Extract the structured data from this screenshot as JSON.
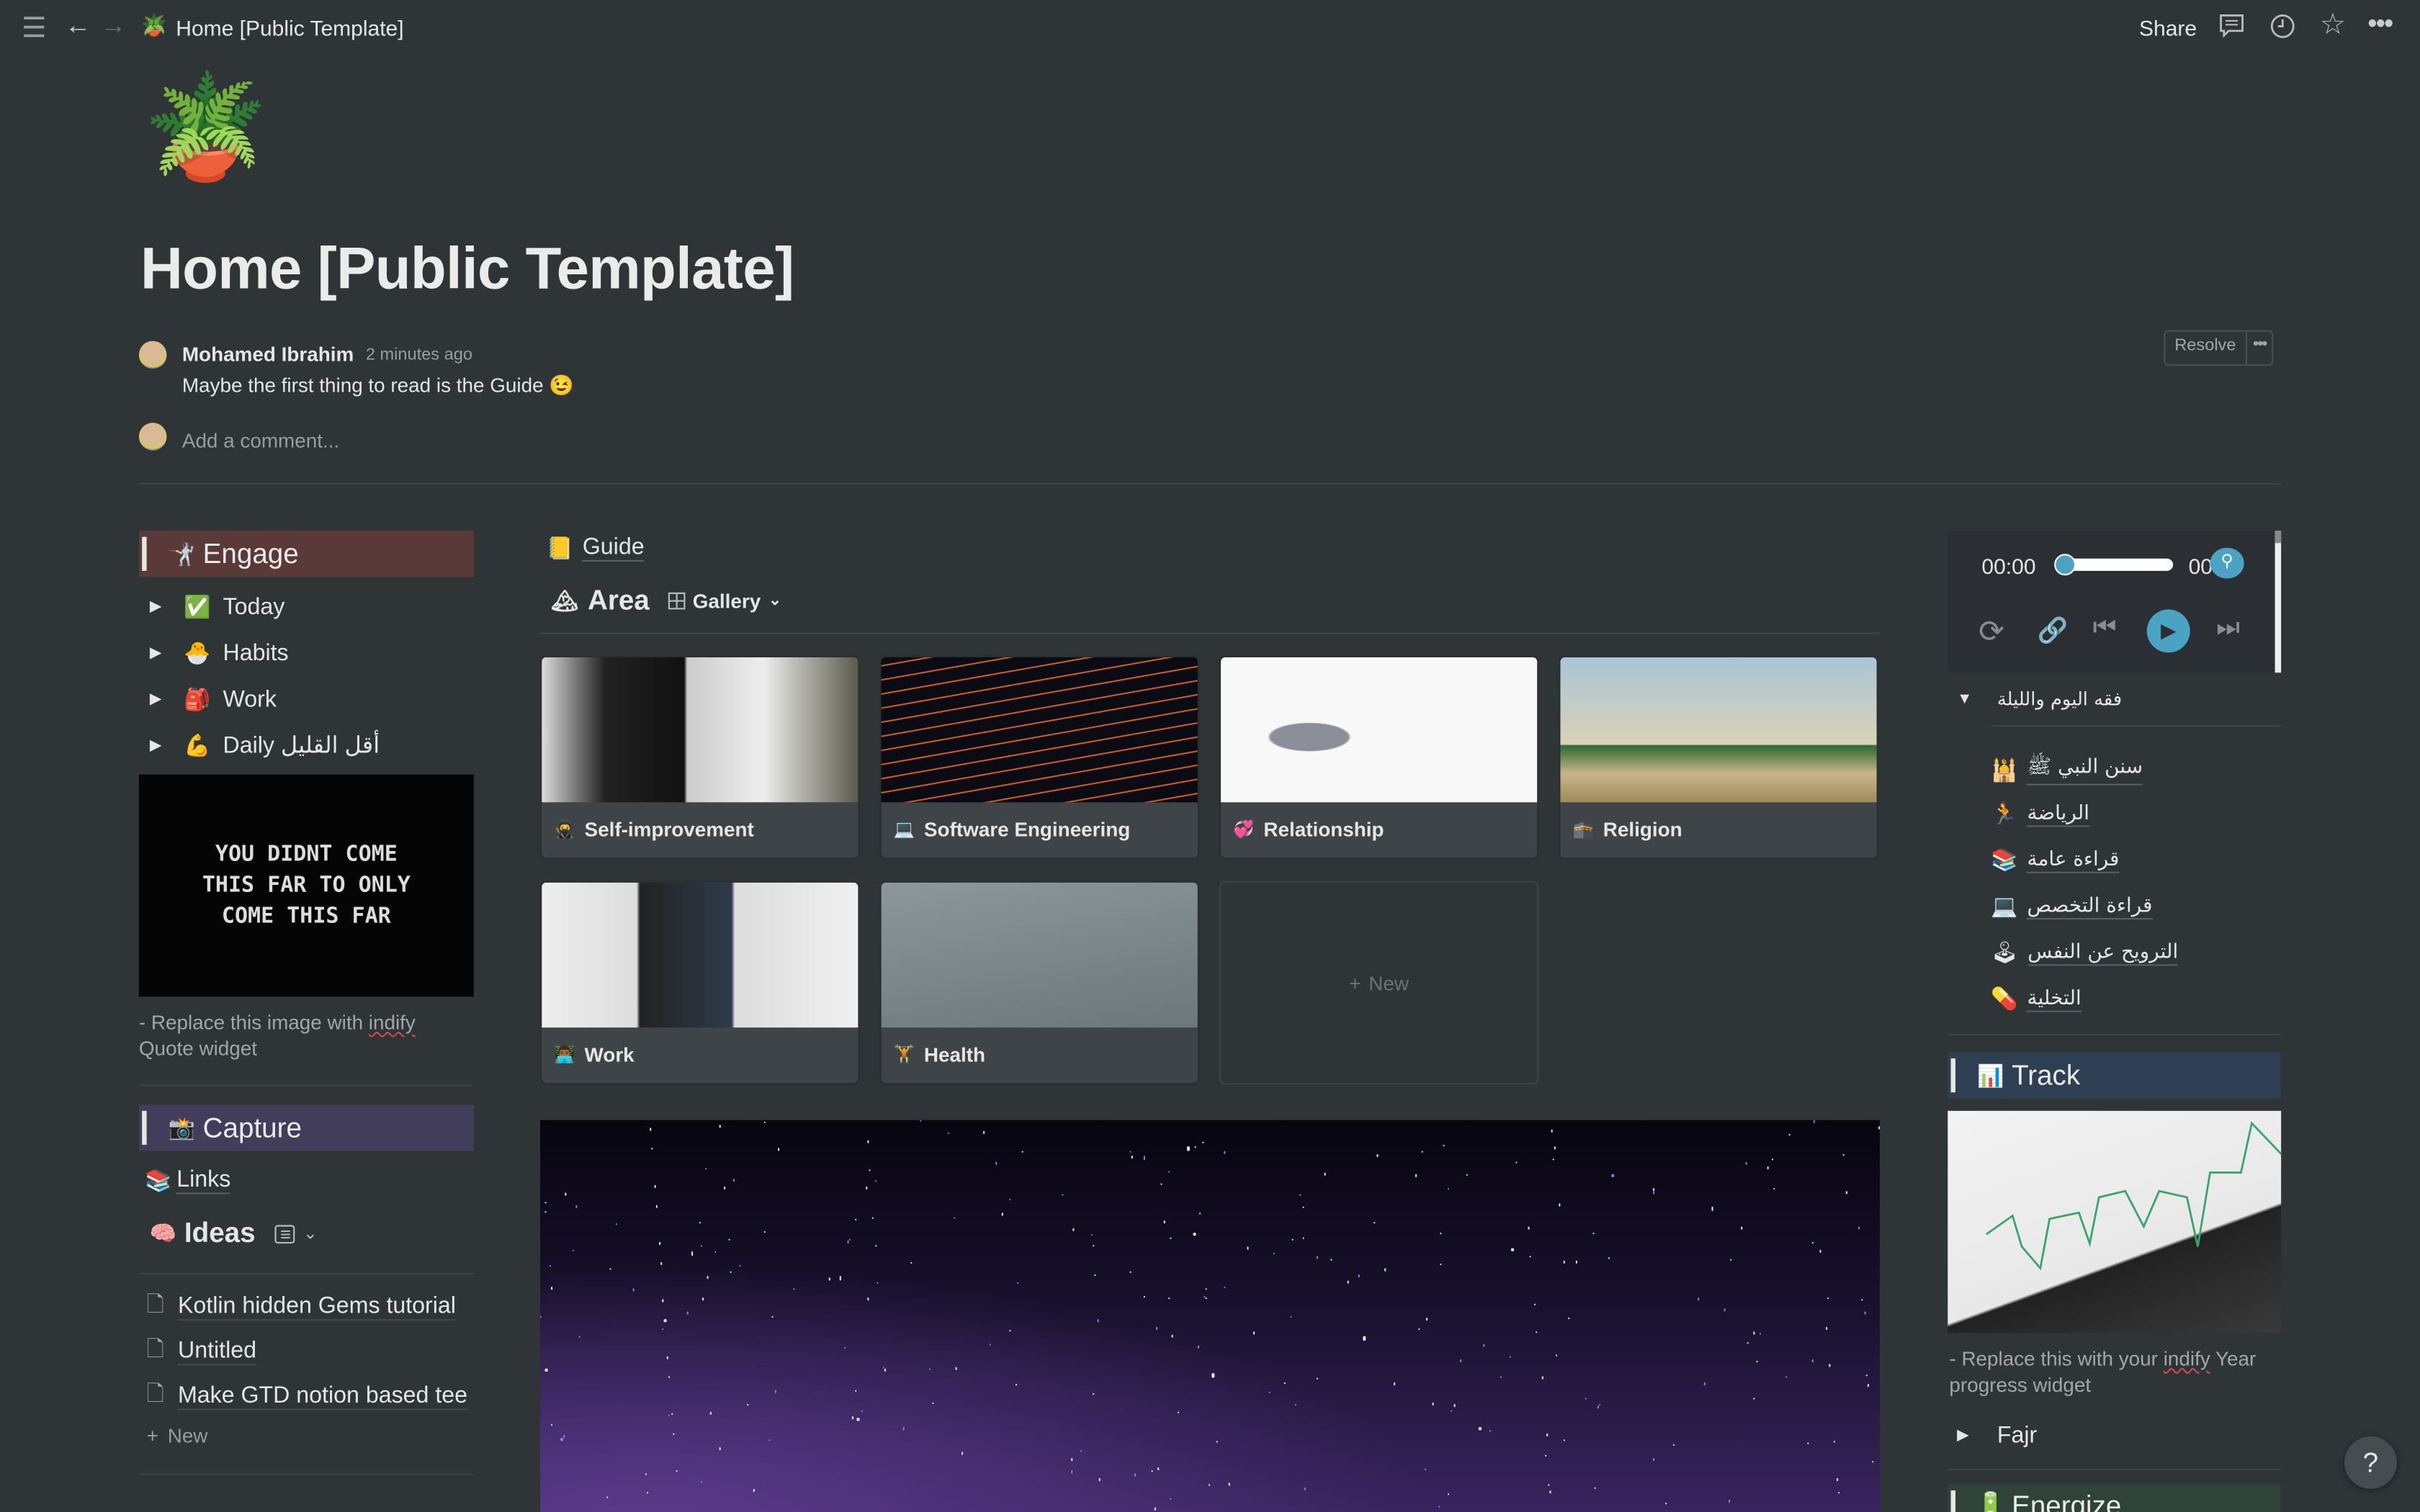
{
  "topbar": {
    "title": "Home [Public Template]",
    "page_icon": "🪴",
    "share": "Share",
    "icons": [
      "menu-icon",
      "back-arrow-icon",
      "forward-arrow-icon",
      "comment-icon",
      "clock-icon",
      "star-icon",
      "more-icon"
    ]
  },
  "page": {
    "icon": "🪴",
    "title": "Home [Public Template]"
  },
  "comment": {
    "author": "Mohamed Ibrahim",
    "time": "2 minutes ago",
    "body": "Maybe the first thing to read is the Guide 😉",
    "resolve": "Resolve",
    "placeholder": "Add a comment..."
  },
  "left": {
    "engage": {
      "icon": "🤺",
      "label": "Engage",
      "color": "#5a3a38"
    },
    "engage_items": [
      {
        "icon": "✅",
        "label": "Today"
      },
      {
        "icon": "🐣",
        "label": "Habits"
      },
      {
        "icon": "🎒",
        "label": "Work"
      },
      {
        "icon": "💪",
        "label": "Daily أقل القليل"
      }
    ],
    "quote_image_text": "YOU DIDNT COME THIS FAR TO ONLY COME THIS FAR",
    "caption_pre": "- Replace this image with ",
    "caption_link": "indify",
    "caption_post": " Quote widget",
    "capture": {
      "icon": "📸",
      "label": "Capture",
      "color": "#423d5b"
    },
    "links": {
      "icon": "📚",
      "label": "Links"
    },
    "ideas": {
      "icon": "🧠",
      "label": "Ideas"
    },
    "ideas_items": [
      "Kotlin hidden Gems tutorial",
      "Untitled",
      "Make GTD notion based tee"
    ],
    "new": "New"
  },
  "middle": {
    "guide": {
      "icon": "📒",
      "label": "Guide"
    },
    "area": {
      "icon": "🏔",
      "label": "Area",
      "view": "Gallery"
    },
    "cards": [
      {
        "icon": "🥷",
        "label": "Self-improvement"
      },
      {
        "icon": "💻",
        "label": "Software Engineering"
      },
      {
        "icon": "💞",
        "label": "Relationship"
      },
      {
        "icon": "🕋",
        "label": "Religion"
      },
      {
        "icon": "👨🏾‍💻",
        "label": "Work"
      },
      {
        "icon": "🏋",
        "label": "Health"
      }
    ],
    "new": "New"
  },
  "right": {
    "player": {
      "current": "00:00",
      "total": "00",
      "accent": "#4aa3c2",
      "progress": 0
    },
    "toggle": "فقه اليوم والليلة",
    "items": [
      {
        "icon": "🕌",
        "label": "سنن النبي ﷺ"
      },
      {
        "icon": "🏃",
        "label": "الرياضة"
      },
      {
        "icon": "📚",
        "label": "قراءة عامة"
      },
      {
        "icon": "💻",
        "label": "قراءة التخصص"
      },
      {
        "icon": "🕹",
        "label": "الترويح عن النفس"
      },
      {
        "icon": "💊",
        "label": "التخلية"
      }
    ],
    "track": {
      "icon": "📊",
      "label": "Track",
      "color": "#2e3f54"
    },
    "caption_pre": "- Replace this with your ",
    "caption_link": "indify",
    "caption_post": " Year progress widget",
    "fajr": "Fajr",
    "energize": {
      "icon": "🔋",
      "label": "Energize",
      "color": "#2f4338"
    }
  },
  "help": "?"
}
